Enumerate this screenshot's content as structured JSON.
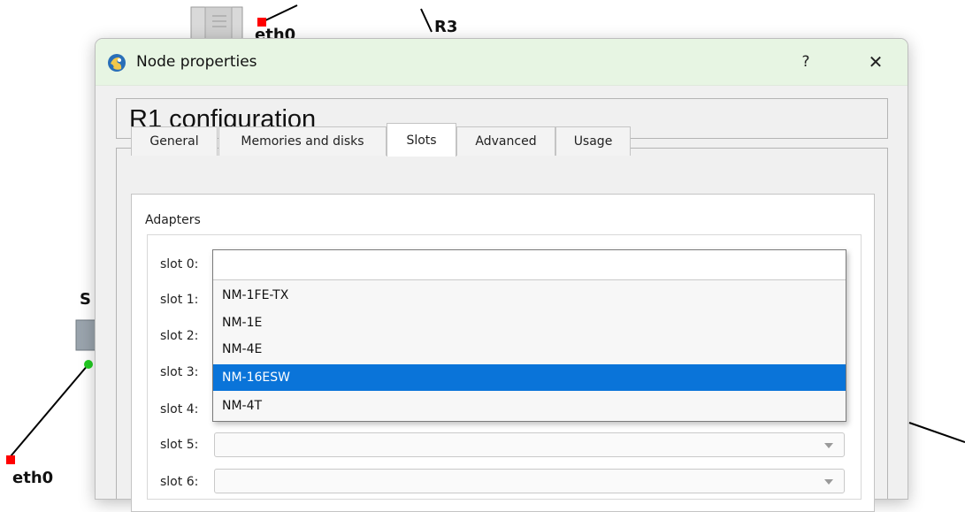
{
  "topology": {
    "labels": [
      "eth0",
      "R3",
      "S",
      "eth0"
    ]
  },
  "dialog": {
    "title": "Node properties",
    "help_label": "?",
    "close_label": "✕",
    "heading": "R1 configuration",
    "tabs": [
      {
        "label": "General"
      },
      {
        "label": "Memories and disks"
      },
      {
        "label": "Slots",
        "active": true
      },
      {
        "label": "Advanced"
      },
      {
        "label": "Usage"
      }
    ],
    "group_label": "Adapters",
    "slots": [
      {
        "label": "slot 0:",
        "value": ""
      },
      {
        "label": "slot 1:",
        "value": ""
      },
      {
        "label": "slot 2:",
        "value": ""
      },
      {
        "label": "slot 3:",
        "value": ""
      },
      {
        "label": "slot 4:",
        "value": ""
      },
      {
        "label": "slot 5:",
        "value": ""
      },
      {
        "label": "slot 6:",
        "value": ""
      }
    ],
    "open_dropdown": {
      "for_slot": "slot 0:",
      "options": [
        "NM-1FE-TX",
        "NM-1E",
        "NM-4E",
        "NM-16ESW",
        "NM-4T"
      ],
      "highlighted": "NM-16ESW"
    }
  },
  "colors": {
    "titlebar_bg": "#e7f5e3",
    "selection": "#0a74d9",
    "port_red": "#ff0000",
    "port_green": "#22cc22"
  }
}
